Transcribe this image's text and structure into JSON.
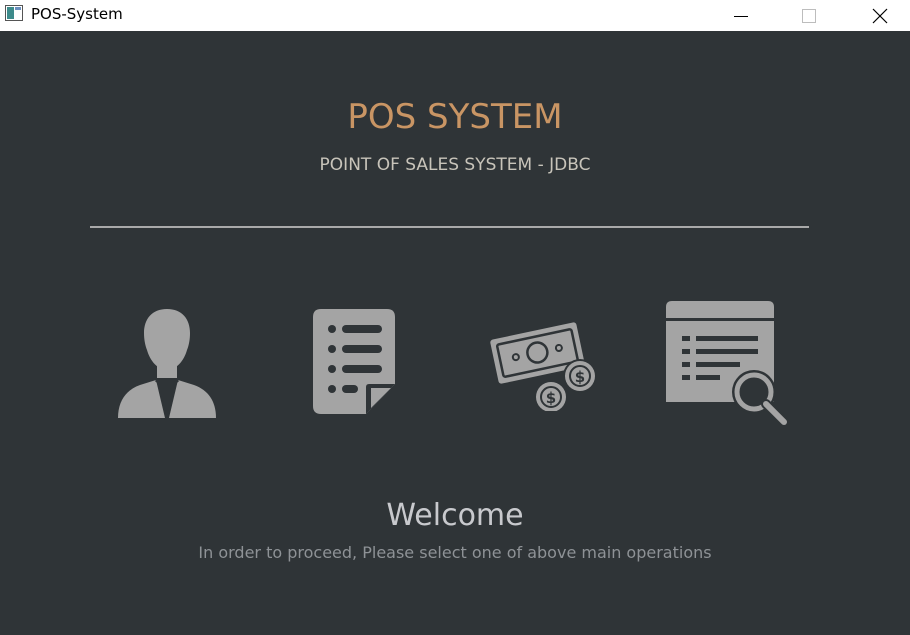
{
  "window": {
    "title": "POS-System",
    "controls": {
      "minimize_icon": "minimize-icon",
      "maximize_icon": "maximize-icon",
      "close_icon": "close-icon"
    }
  },
  "header": {
    "title": "POS SYSTEM",
    "subtitle": "POINT OF SALES SYSTEM - JDBC"
  },
  "operations": [
    {
      "icon": "customer-icon"
    },
    {
      "icon": "orders-document-icon"
    },
    {
      "icon": "payments-money-icon"
    },
    {
      "icon": "search-report-icon"
    }
  ],
  "welcome": {
    "title": "Welcome",
    "message": "In order to proceed, Please select one of above main operations"
  },
  "colors": {
    "background": "#2f3437",
    "accent": "#c99564",
    "icon": "#a4a4a4",
    "subtitle": "#c8c4ba",
    "divider": "#a9a9a9"
  }
}
